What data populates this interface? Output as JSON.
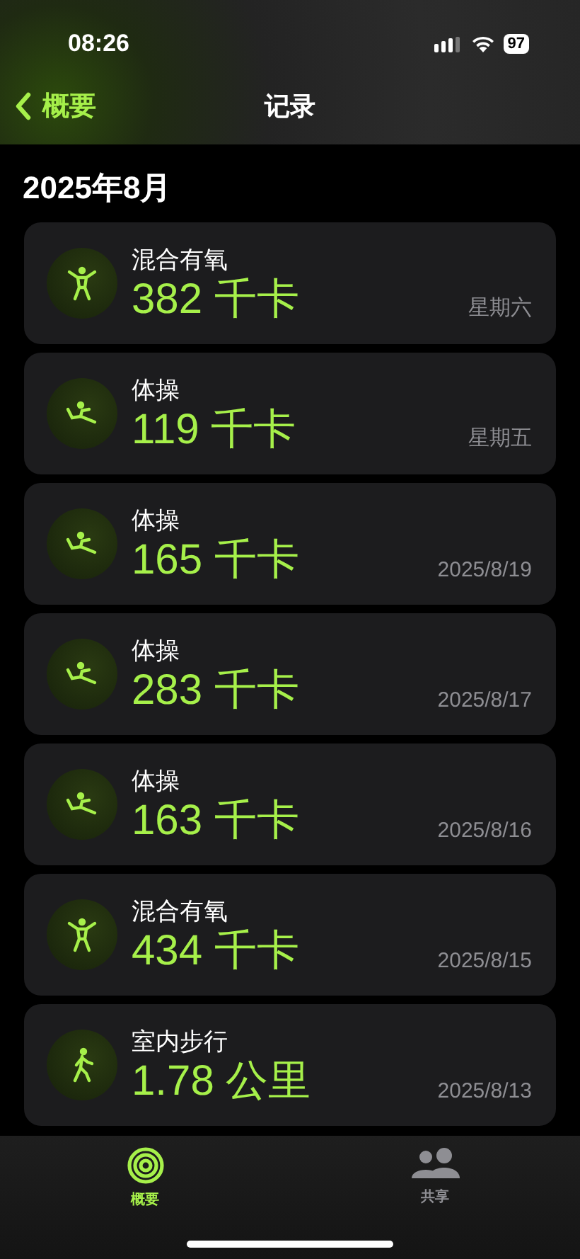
{
  "status_bar": {
    "time": "08:26",
    "battery": "97"
  },
  "nav": {
    "back": "概要",
    "title": "记录"
  },
  "section_title": "2025年8月",
  "workouts": [
    {
      "kind": "mixed",
      "name": "混合有氧",
      "value": "382 千卡",
      "date": "星期六"
    },
    {
      "kind": "gym",
      "name": "体操",
      "value": "119 千卡",
      "date": "星期五"
    },
    {
      "kind": "gym",
      "name": "体操",
      "value": "165 千卡",
      "date": "2025/8/19"
    },
    {
      "kind": "gym",
      "name": "体操",
      "value": "283 千卡",
      "date": "2025/8/17"
    },
    {
      "kind": "gym",
      "name": "体操",
      "value": "163 千卡",
      "date": "2025/8/16"
    },
    {
      "kind": "mixed",
      "name": "混合有氧",
      "value": "434 千卡",
      "date": "2025/8/15"
    },
    {
      "kind": "walk",
      "name": "室内步行",
      "value": "1.78 公里",
      "date": "2025/8/13"
    }
  ],
  "tab_bar": [
    {
      "kind": "rings",
      "label": "概要",
      "selected": true
    },
    {
      "kind": "people",
      "label": "共享",
      "selected": false
    }
  ]
}
